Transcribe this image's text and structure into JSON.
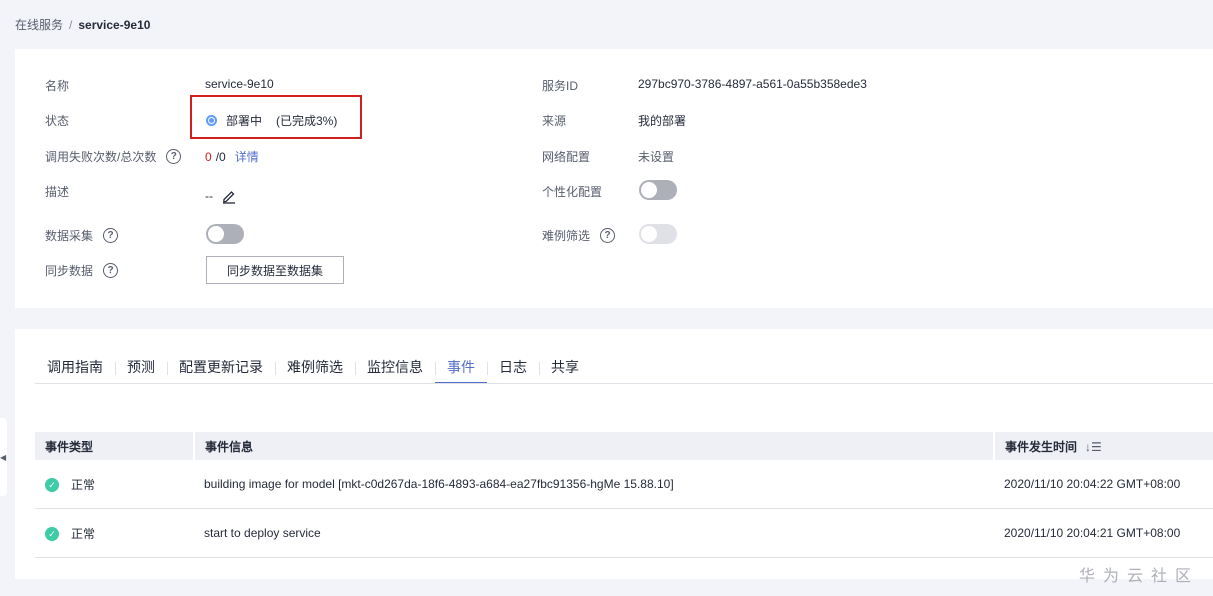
{
  "breadcrumb": {
    "parent": "在线服务",
    "separator": "/",
    "current": "service-9e10"
  },
  "info": {
    "name_label": "名称",
    "name_value": "service-9e10",
    "status_label": "状态",
    "status_text": "部署中",
    "status_progress": "(已完成3%)",
    "calls_label": "调用失败次数/总次数",
    "calls_failed": "0",
    "calls_total": "/0",
    "calls_detail": "详情",
    "desc_label": "描述",
    "desc_value": "--",
    "collect_label": "数据采集",
    "collect_enabled": false,
    "sync_label": "同步数据",
    "sync_button": "同步数据至数据集",
    "service_id_label": "服务ID",
    "service_id_value": "297bc970-3786-4897-a561-0a55b358ede3",
    "source_label": "来源",
    "source_value": "我的部署",
    "network_label": "网络配置",
    "network_value": "未设置",
    "personal_label": "个性化配置",
    "personal_enabled": false,
    "hard_label": "难例筛选",
    "hard_enabled": false
  },
  "tabs": [
    {
      "label": "调用指南",
      "active": false
    },
    {
      "label": "预测",
      "active": false
    },
    {
      "label": "配置更新记录",
      "active": false
    },
    {
      "label": "难例筛选",
      "active": false
    },
    {
      "label": "监控信息",
      "active": false
    },
    {
      "label": "事件",
      "active": true
    },
    {
      "label": "日志",
      "active": false
    },
    {
      "label": "共享",
      "active": false
    }
  ],
  "events": {
    "columns": [
      "事件类型",
      "事件信息",
      "事件发生时间"
    ],
    "rows": [
      {
        "type": "正常",
        "info": "building image for model [mkt-c0d267da-18f6-4893-a684-ea27fbc91356-hgMe 15.88.10]",
        "time": "2020/11/10 20:04:22 GMT+08:00"
      },
      {
        "type": "正常",
        "info": "start to deploy service",
        "time": "2020/11/10 20:04:21 GMT+08:00"
      }
    ]
  },
  "watermark": "华为云社区",
  "colors": {
    "accent": "#526ecc",
    "highlight_box": "#d0201d",
    "success": "#3dcca6",
    "deploying": "#5e9cf7"
  }
}
